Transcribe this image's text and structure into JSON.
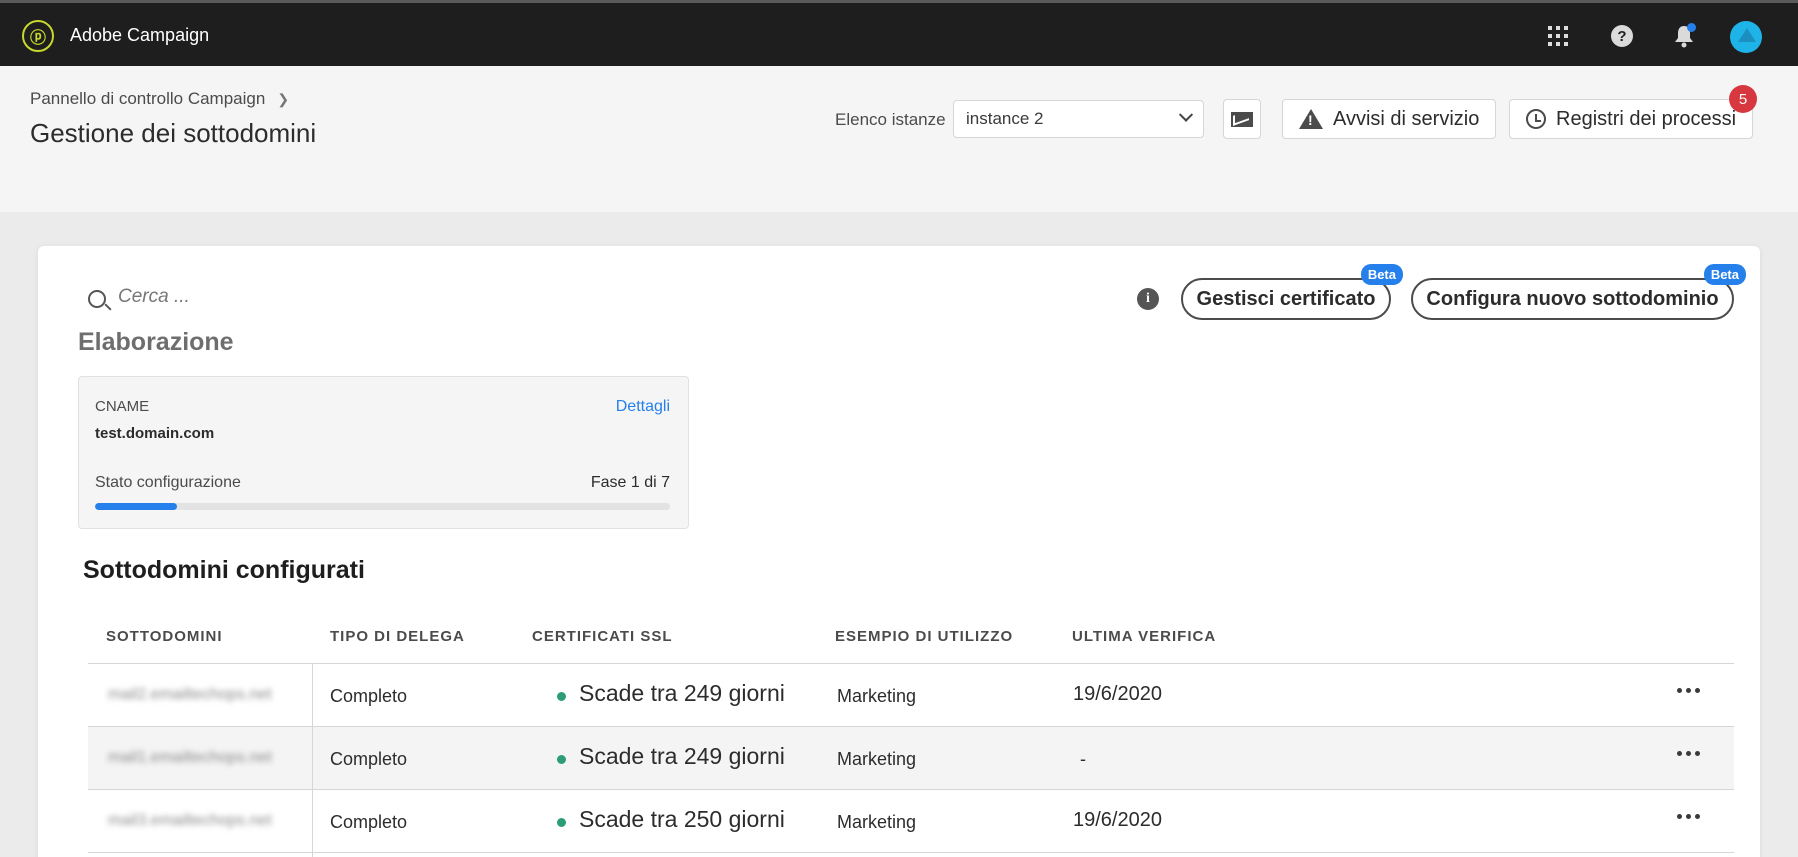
{
  "topbar": {
    "app_title": "Adobe Campaign",
    "icons": [
      "adobe-campaign-logo-icon",
      "apps-grid-icon",
      "help-icon",
      "notifications-bell-icon",
      "user-avatar"
    ]
  },
  "header": {
    "breadcrumb": "Pannello di controllo Campaign",
    "page_title": "Gestione dei sottodomini",
    "instance_label": "Elenco istanze",
    "instance_value": "instance 2",
    "alerts_label": "Avvisi di servizio",
    "logs_label": "Registri dei processi",
    "logs_badge": "5"
  },
  "toolbar": {
    "search_placeholder": "Cerca ...",
    "cert_button": "Gestisci certificato",
    "new_button": "Configura nuovo sottodominio",
    "beta_label": "Beta"
  },
  "processing": {
    "section_title": "Elaborazione",
    "cname_label": "CNAME",
    "details_link": "Dettagli",
    "cname_value": "test.domain.com",
    "status_label": "Stato configurazione",
    "step_label": "Fase 1 di 7",
    "progress_fraction": 0.143
  },
  "table": {
    "title": "Sottodomini configurati",
    "headers": [
      "SOTTODOMINI",
      "TIPO DI DELEGA",
      "CERTIFICATI SSL",
      "ESEMPIO DI UTILIZZO",
      "ULTIMA VERIFICA"
    ],
    "rows": [
      {
        "subdomain": "mail2.emailtechops.net",
        "delegation": "Completo",
        "ssl": "Scade tra 249  giorni",
        "usage": "Marketing",
        "last_check": "19/6/2020"
      },
      {
        "subdomain": "mail1.emailtechops.net",
        "delegation": "Completo",
        "ssl": "Scade tra 249  giorni",
        "usage": "Marketing",
        "last_check": "-"
      },
      {
        "subdomain": "mail3.emailtechops.net",
        "delegation": "Completo",
        "ssl": "Scade tra 250  giorni",
        "usage": "Marketing",
        "last_check": "19/6/2020"
      }
    ]
  },
  "colors": {
    "accent": "#2680eb",
    "status_ok": "#2d9d78",
    "badge": "#d7373f",
    "topbar": "#1e1e1e"
  }
}
